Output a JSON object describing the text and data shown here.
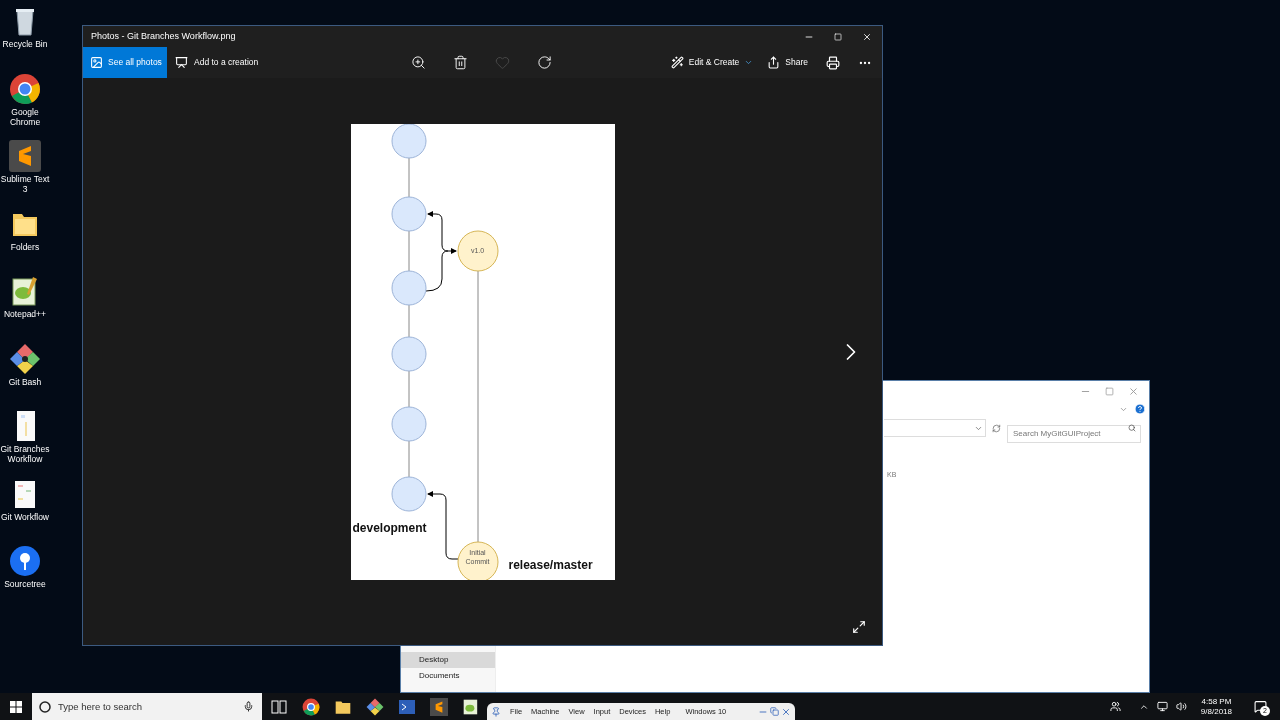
{
  "desktop_icons": [
    {
      "label": "Recycle Bin"
    },
    {
      "label": "Google Chrome"
    },
    {
      "label": "Sublime Text 3"
    },
    {
      "label": "Folders"
    },
    {
      "label": "Notepad++"
    },
    {
      "label": "Git Bash"
    },
    {
      "label": "Git Branches Workflow"
    },
    {
      "label": "Git Workflow"
    },
    {
      "label": "Sourcetree"
    }
  ],
  "photos_window": {
    "title": "Photos - Git Branches Workflow.png",
    "toolbar": {
      "see_all": "See all photos",
      "add_to_creation": "Add to a creation",
      "tools": [
        {
          "kind": "zoom",
          "disabled": false
        },
        {
          "kind": "delete",
          "disabled": false
        },
        {
          "kind": "favorite",
          "disabled": true
        },
        {
          "kind": "rotate",
          "disabled": false
        }
      ],
      "edit_create": "Edit & Create",
      "share": "Share"
    },
    "diagram": {
      "branch_labels": [
        "development",
        "release/master"
      ],
      "tag_nodes": [
        {
          "label": "v1.0"
        },
        {
          "label": "Initial Commit"
        }
      ]
    }
  },
  "explorer_window": {
    "search": {
      "placeholder": "Search MyGitGUIProject"
    },
    "size_text": "KB",
    "nav_items": [
      {
        "label": "Desktop",
        "selected": true
      },
      {
        "label": "Documents",
        "selected": false
      }
    ]
  },
  "taskbar": {
    "search": {
      "placeholder": "Type here to search"
    },
    "vm_menu": [
      "File",
      "Machine",
      "View",
      "Input",
      "Devices",
      "Help"
    ],
    "vm_name": "Windows 10",
    "time": "4:58 PM",
    "date": "9/8/2018",
    "notifications": "2"
  }
}
